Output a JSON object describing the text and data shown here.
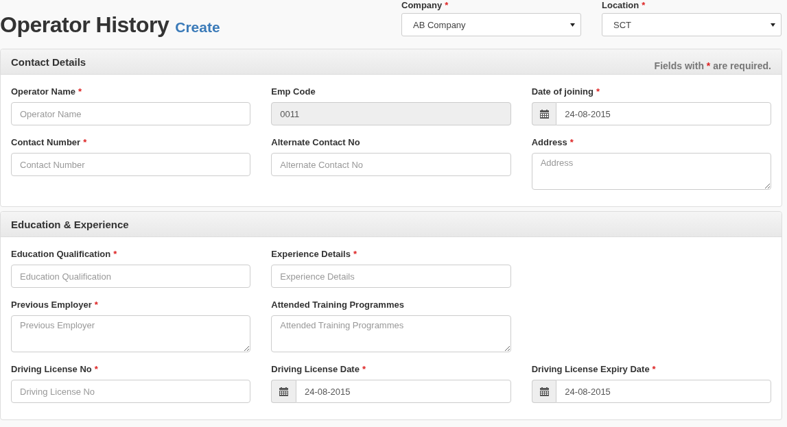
{
  "page": {
    "title": "Operator History",
    "subtitle": "Create"
  },
  "header_selects": [
    {
      "label": "Company",
      "required_mark": "*",
      "value": "AB Company"
    },
    {
      "label": "Location",
      "required_mark": "*",
      "value": "SCT"
    }
  ],
  "panels": [
    {
      "title": "Contact Details",
      "note": {
        "before": "Fields with",
        "mark": "*",
        "after": "are required."
      },
      "rows": [
        [
          {
            "kind": "text",
            "label": "Operator Name",
            "required_mark": "*",
            "placeholder": "Operator Name"
          },
          {
            "kind": "readonly",
            "label": "Emp Code",
            "value": "0011"
          },
          {
            "kind": "date",
            "label": "Date of joining",
            "required_mark": "*",
            "value": "24-08-2015"
          }
        ],
        [
          {
            "kind": "text",
            "label": "Contact Number",
            "required_mark": "*",
            "placeholder": "Contact Number"
          },
          {
            "kind": "text",
            "label": "Alternate Contact No",
            "placeholder": "Alternate Contact No"
          },
          {
            "kind": "textarea",
            "label": "Address",
            "required_mark": "*",
            "placeholder": "Address"
          }
        ]
      ]
    },
    {
      "title": "Education & Experience",
      "rows": [
        [
          {
            "kind": "text",
            "label": "Education Qualification",
            "required_mark": "*",
            "placeholder": "Education Qualification"
          },
          {
            "kind": "text",
            "label": "Experience Details",
            "required_mark": "*",
            "placeholder": "Experience Details"
          }
        ],
        [
          {
            "kind": "textarea",
            "label": "Previous Employer",
            "required_mark": "*",
            "placeholder": "Previous Employer"
          },
          {
            "kind": "textarea",
            "label": "Attended Training Programmes",
            "placeholder": "Attended Training Programmes"
          }
        ],
        [
          {
            "kind": "text",
            "label": "Driving License No",
            "required_mark": "*",
            "placeholder": "Driving License No"
          },
          {
            "kind": "date",
            "label": "Driving License Date",
            "required_mark": "*",
            "value": "24-08-2015"
          },
          {
            "kind": "date",
            "label": "Driving License Expiry Date",
            "required_mark": "*",
            "value": "24-08-2015"
          }
        ]
      ]
    }
  ]
}
